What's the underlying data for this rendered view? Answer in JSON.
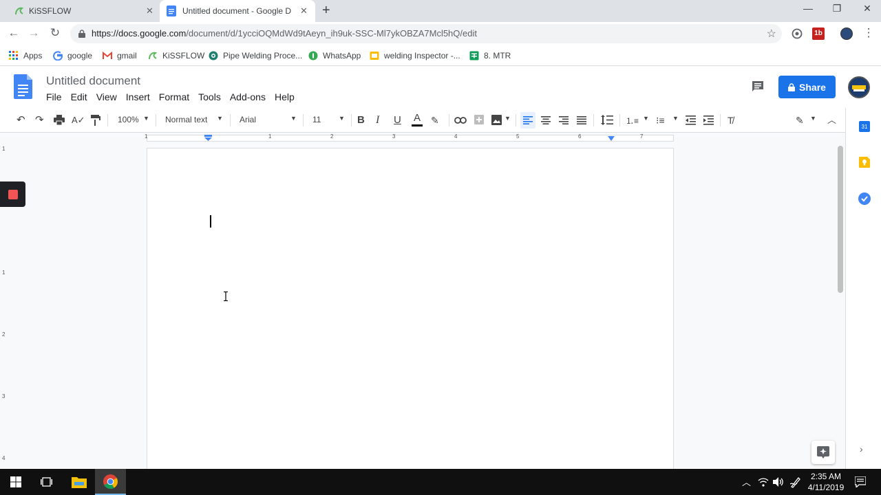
{
  "browser": {
    "tabs": [
      {
        "title": "KiSSFLOW",
        "active": false
      },
      {
        "title": "Untitled document - Google Docs",
        "active": true
      }
    ],
    "url_host": "https://docs.google.com",
    "url_path": "/document/d/1ycciOQMdWd9tAeyn_ih9uk-SSC-Ml7ykOBZA7Mcl5hQ/edit",
    "bookmarks": [
      {
        "label": "Apps"
      },
      {
        "label": "google"
      },
      {
        "label": "gmail"
      },
      {
        "label": "KiSSFLOW"
      },
      {
        "label": "Pipe Welding Proce..."
      },
      {
        "label": "WhatsApp"
      },
      {
        "label": "welding Inspector -..."
      },
      {
        "label": "8. MTR"
      }
    ],
    "extension_badge": "1b"
  },
  "docs": {
    "title": "Untitled document",
    "menu": [
      "File",
      "Edit",
      "View",
      "Insert",
      "Format",
      "Tools",
      "Add-ons",
      "Help"
    ],
    "share_label": "Share",
    "toolbar": {
      "zoom": "100%",
      "style": "Normal text",
      "font": "Arial",
      "font_size": "11",
      "bold": "B",
      "italic": "I",
      "underline": "U",
      "text_color": "A"
    },
    "ruler_numbers": [
      "1",
      "1",
      "2",
      "3",
      "4",
      "5",
      "6",
      "7"
    ],
    "vruler_numbers": [
      "1",
      "1",
      "2",
      "3",
      "4"
    ],
    "side_calendar": "31"
  },
  "taskbar": {
    "time": "2:35 AM",
    "date": "4/11/2019"
  },
  "colors": {
    "docs_blue": "#4285f4",
    "share_blue": "#1a73e8",
    "record_red": "#f05454"
  }
}
